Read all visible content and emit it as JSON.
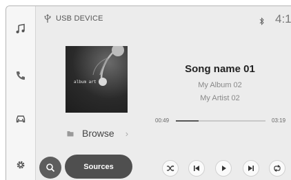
{
  "header": {
    "source_icon": "usb-icon",
    "device_label": "USB DEVICE",
    "status_icon": "bluetooth-icon",
    "clock": "4:1"
  },
  "sidebar": {
    "items": [
      {
        "icon": "music-note-icon"
      },
      {
        "icon": "phone-icon"
      },
      {
        "icon": "car-icon"
      },
      {
        "icon": "gear-icon"
      }
    ]
  },
  "now_playing": {
    "album_art_text": "album art",
    "song": "Song name 01",
    "album": "My Album 02",
    "artist": "My Artist 02",
    "elapsed": "00:49",
    "total": "03:19",
    "progress_fraction": 0.25
  },
  "browse": {
    "icon": "folder-icon",
    "label": "Browse"
  },
  "bottom": {
    "search_icon": "search-icon",
    "sources_label": "Sources",
    "controls": [
      "shuffle-icon",
      "previous-track-icon",
      "play-icon",
      "next-track-icon",
      "repeat-icon"
    ]
  },
  "colors": {
    "background": "#ececec",
    "sidebar": "#f6f6f6",
    "button_dark": "#4f4f4f"
  }
}
